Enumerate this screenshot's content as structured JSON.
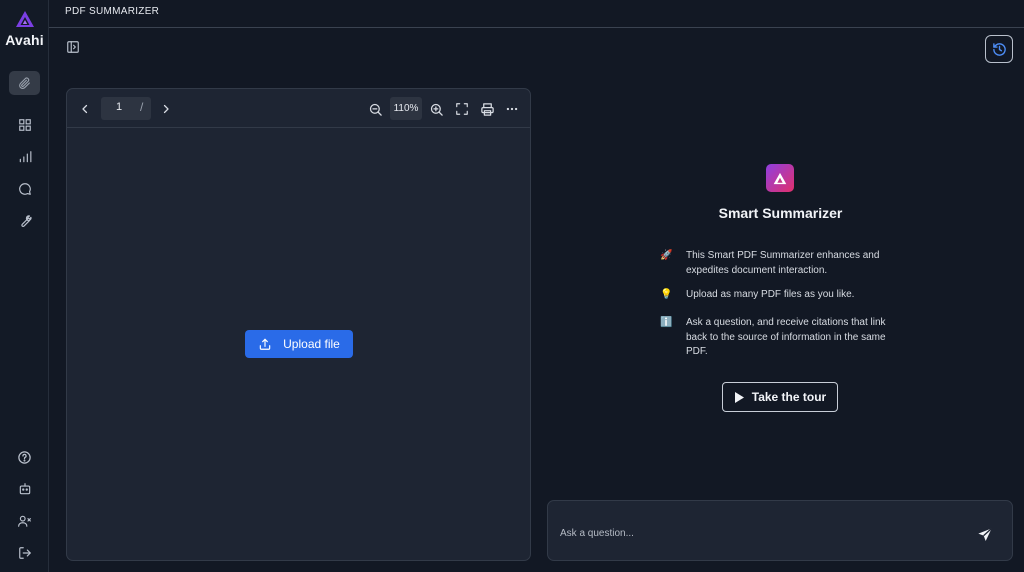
{
  "app": {
    "title": "PDF SUMMARIZER",
    "brand": "Avahi"
  },
  "sidebar": {
    "top_items": [
      {
        "icon": "paperclip-icon",
        "active": true
      },
      {
        "icon": "grid-icon"
      },
      {
        "icon": "bar-chart-icon"
      },
      {
        "icon": "chat-bubble-icon"
      },
      {
        "icon": "wrench-icon"
      }
    ],
    "bottom_items": [
      {
        "icon": "help-circle-icon"
      },
      {
        "icon": "bot-icon"
      },
      {
        "icon": "user-x-icon"
      },
      {
        "icon": "logout-icon"
      }
    ]
  },
  "viewer": {
    "page_number": "1",
    "page_separator": "/",
    "zoom": "110%",
    "upload_label": "Upload file"
  },
  "info": {
    "title": "Smart Summarizer",
    "features": [
      {
        "icon": "🚀",
        "text": "This Smart PDF Summarizer enhances and expedites document interaction."
      },
      {
        "icon": "💡",
        "text": "Upload as many PDF files as you like."
      },
      {
        "icon": "ℹ️",
        "text": "Ask a question, and receive citations that link back to the source of information in the same PDF."
      }
    ],
    "tour_label": "Take the tour"
  },
  "chat": {
    "placeholder": "Ask a question..."
  },
  "colors": {
    "background": "#121824",
    "panel": "#1e2533",
    "accent_blue": "#2a6be8",
    "brand_purple": "#8f3fe0",
    "brand_pink": "#e1306c"
  }
}
